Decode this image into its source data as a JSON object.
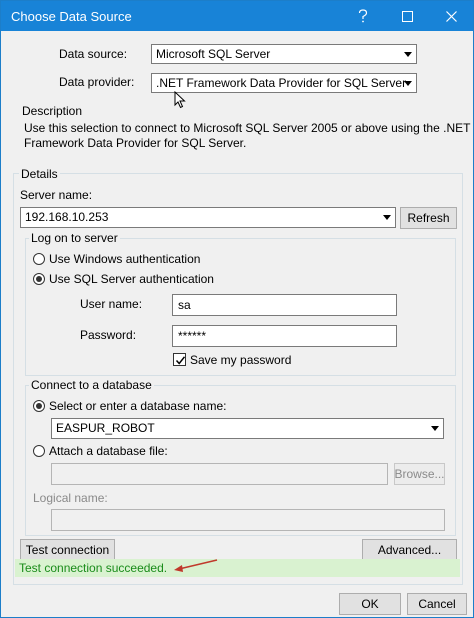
{
  "window": {
    "title": "Choose Data Source",
    "help_icon": "question-mark-icon",
    "maximize_icon": "maximize-icon",
    "close_icon": "close-icon"
  },
  "data_source": {
    "label": "Data source:",
    "value": "Microsoft SQL Server"
  },
  "data_provider": {
    "label": "Data provider:",
    "value": ".NET Framework Data Provider for SQL Server"
  },
  "description": {
    "title": "Description",
    "text_line1": "Use this selection to connect to Microsoft SQL Server 2005 or above using the .NET",
    "text_line2": "Framework Data Provider for SQL Server."
  },
  "details": {
    "title": "Details",
    "server_name_label": "Server name:",
    "server_name_value": "192.168.10.253",
    "refresh_label": "Refresh",
    "logon": {
      "title": "Log on to server",
      "windows_auth_label": "Use Windows authentication",
      "sql_auth_label": "Use SQL Server authentication",
      "user_name_label": "User name:",
      "user_name_value": "sa",
      "password_label": "Password:",
      "password_value": "******",
      "save_password_label": "Save my password",
      "save_password_checked": true,
      "selected": "sql"
    },
    "connect": {
      "title": "Connect to a database",
      "select_db_label": "Select or enter a database name:",
      "database_value": "EASPUR_ROBOT",
      "attach_label": "Attach a database file:",
      "attach_value": "",
      "browse_label": "Browse...",
      "logical_name_label": "Logical name:",
      "logical_name_value": "",
      "selected": "select"
    }
  },
  "actions": {
    "test_connection_label": "Test connection",
    "advanced_label": "Advanced...",
    "status_text": "Test connection succeeded.",
    "ok_label": "OK",
    "cancel_label": "Cancel"
  },
  "colors": {
    "titlebar": "#1883d7",
    "status_bg": "#d9f2d0",
    "status_text": "#1a8c1a",
    "annotation_arrow": "#c0392b"
  }
}
